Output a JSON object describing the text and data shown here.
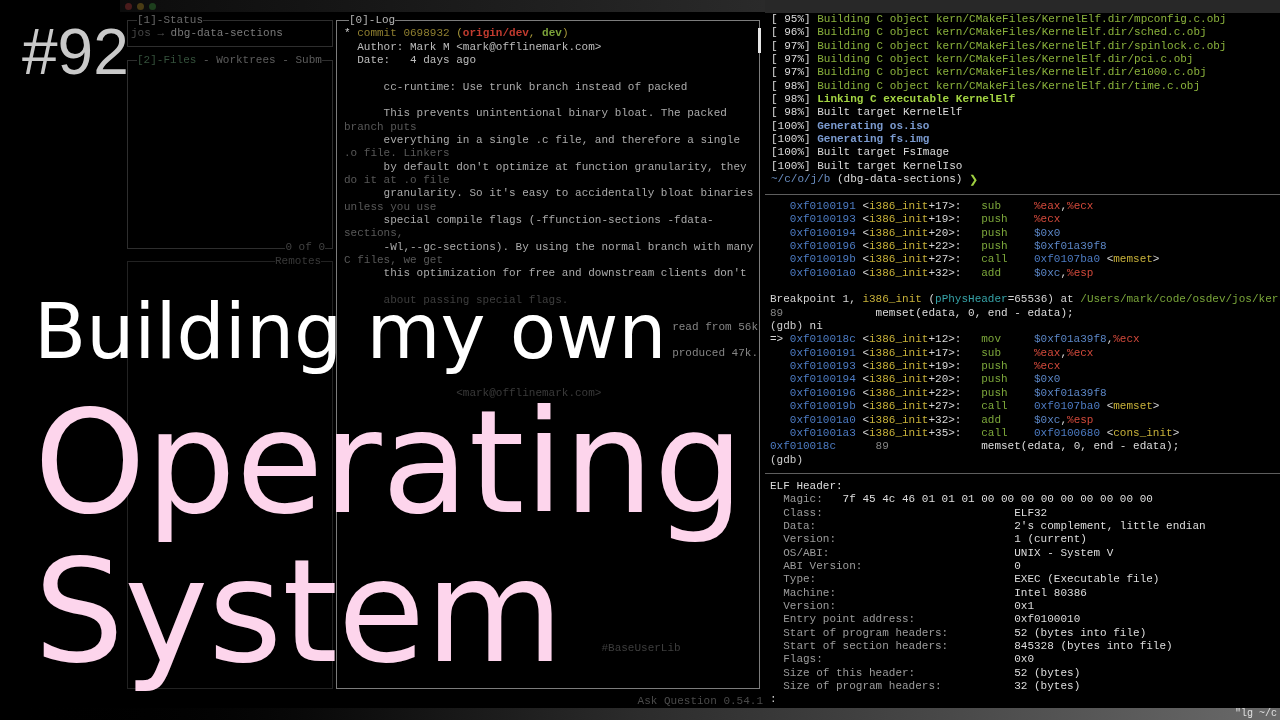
{
  "episode_number": "#92",
  "headline": {
    "intro": "Building my own",
    "title_lines": [
      "Operating",
      "System"
    ]
  },
  "lazygit": {
    "status_panel": {
      "title": "[1]-Status",
      "repo": "jos",
      "arrow": "→",
      "branch": "dbg-data-sections"
    },
    "files_panel": {
      "tabs": [
        {
          "label": "[2]-Files",
          "selected": true
        },
        {
          "label": "- Worktrees",
          "selected": false
        },
        {
          "label": "- Subm",
          "selected": false
        }
      ],
      "count": "0 of 0"
    },
    "branches_panel": {
      "title": "Remotes"
    },
    "log_panel": {
      "title": "[0]-Log",
      "lines": [
        {
          "kind": "commit",
          "segs": [
            {
              "kind": "graph",
              "text": "*"
            },
            {
              "kind": "hash",
              "text": " commit 0698932 "
            },
            {
              "kind": "punct",
              "text": "("
            },
            {
              "kind": "remote",
              "text": "origin/dev"
            },
            {
              "kind": "punct",
              "text": ", "
            },
            {
              "kind": "local",
              "text": "dev"
            },
            {
              "kind": "punct",
              "text": ")"
            }
          ]
        },
        {
          "kind": "meta",
          "text": "Author: Mark M <mark@offlinemark.com>"
        },
        {
          "kind": "meta",
          "text": "Date:   4 days ago"
        },
        {
          "kind": "blank"
        },
        {
          "kind": "body",
          "text": "cc-runtime: Use trunk branch instead of packed"
        },
        {
          "kind": "blank"
        },
        {
          "kind": "body",
          "text": "This prevents unintentional binary bloat. The packed"
        },
        {
          "kind": "wrap",
          "text": "branch puts"
        },
        {
          "kind": "body",
          "text": "everything in a single .c file, and therefore a single"
        },
        {
          "kind": "wrap",
          "text": ".o file. Linkers"
        },
        {
          "kind": "body",
          "text": "by default don't optimize at function granularity, they"
        },
        {
          "kind": "wrap",
          "text": "do it at .o file"
        },
        {
          "kind": "body",
          "text": "granularity. So it's easy to accidentally bloat binaries"
        },
        {
          "kind": "wrap",
          "text": "unless you use"
        },
        {
          "kind": "body",
          "text": "special compile flags (-ffunction-sections -fdata-"
        },
        {
          "kind": "wrap",
          "text": "sections,"
        },
        {
          "kind": "body",
          "text": "-Wl,--gc-sections). By using the normal branch with many"
        },
        {
          "kind": "wrap",
          "text": "C files, we get"
        },
        {
          "kind": "body",
          "text": "this optimization for free and downstream clients don't"
        },
        {
          "kind": "blank"
        },
        {
          "kind": "faded",
          "text": "about passing special flags."
        },
        {
          "kind": "blank"
        },
        {
          "kind": "tail",
          "text": "read from 56k"
        },
        {
          "kind": "blank"
        },
        {
          "kind": "tail",
          "text": "produced 47k."
        },
        {
          "kind": "blank"
        },
        {
          "kind": "blank"
        },
        {
          "kind": "faded_meta",
          "text": "<mark@offlinemark.com>"
        }
      ],
      "lower_fragment": "#BaseUserLib"
    },
    "footer": "Ask Question 0.54.1"
  },
  "terminal": {
    "build": {
      "lines": [
        {
          "progress": "[ 95%]",
          "kind": "compile",
          "message": "Building C object kern/CMakeFiles/KernelElf.dir/mpconfig.c.obj"
        },
        {
          "progress": "[ 96%]",
          "kind": "compile",
          "message": "Building C object kern/CMakeFiles/KernelElf.dir/sched.c.obj"
        },
        {
          "progress": "[ 97%]",
          "kind": "compile",
          "message": "Building C object kern/CMakeFiles/KernelElf.dir/spinlock.c.obj"
        },
        {
          "progress": "[ 97%]",
          "kind": "compile",
          "message": "Building C object kern/CMakeFiles/KernelElf.dir/pci.c.obj"
        },
        {
          "progress": "[ 97%]",
          "kind": "compile",
          "message": "Building C object kern/CMakeFiles/KernelElf.dir/e1000.c.obj"
        },
        {
          "progress": "[ 98%]",
          "kind": "compile",
          "message": "Building C object kern/CMakeFiles/KernelElf.dir/time.c.obj"
        },
        {
          "progress": "[ 98%]",
          "kind": "link",
          "message": "Linking C executable KernelElf"
        },
        {
          "progress": "[ 98%]",
          "kind": "built",
          "message": "Built target KernelElf"
        },
        {
          "progress": "[100%]",
          "kind": "generate",
          "message": "Generating os.iso"
        },
        {
          "progress": "[100%]",
          "kind": "generate",
          "message": "Generating fs.img"
        },
        {
          "progress": "[100%]",
          "kind": "built",
          "message": "Built target FsImage"
        },
        {
          "progress": "[100%]",
          "kind": "built",
          "message": "Built target KernelIso"
        }
      ],
      "prompt": {
        "path": "~/c/o/j/b",
        "branch": "(dbg-data-sections)",
        "symbol": "❯"
      }
    },
    "gdb": {
      "lines": [
        {
          "kind": "asm",
          "addr": "0xf0100191",
          "sym": [
            {
              "kind": "p",
              "text": "<"
            },
            {
              "kind": "fn",
              "text": "i386_init"
            },
            {
              "kind": "p",
              "text": "+17>:"
            }
          ],
          "op": "sub",
          "args": [
            {
              "kind": "reg",
              "text": "%eax"
            },
            {
              "kind": "p",
              "text": ","
            },
            {
              "kind": "reg",
              "text": "%ecx"
            }
          ]
        },
        {
          "kind": "asm",
          "addr": "0xf0100193",
          "sym": [
            {
              "kind": "p",
              "text": "<"
            },
            {
              "kind": "fn",
              "text": "i386_init"
            },
            {
              "kind": "p",
              "text": "+19>:"
            }
          ],
          "op": "push",
          "args": [
            {
              "kind": "reg",
              "text": "%ecx"
            }
          ]
        },
        {
          "kind": "asm",
          "addr": "0xf0100194",
          "sym": [
            {
              "kind": "p",
              "text": "<"
            },
            {
              "kind": "fn",
              "text": "i386_init"
            },
            {
              "kind": "p",
              "text": "+20>:"
            }
          ],
          "op": "push",
          "args": [
            {
              "kind": "imm",
              "text": "$0x0"
            }
          ]
        },
        {
          "kind": "asm",
          "addr": "0xf0100196",
          "sym": [
            {
              "kind": "p",
              "text": "<"
            },
            {
              "kind": "fn",
              "text": "i386_init"
            },
            {
              "kind": "p",
              "text": "+22>:"
            }
          ],
          "op": "push",
          "args": [
            {
              "kind": "imm",
              "text": "$0xf01a39f8"
            }
          ]
        },
        {
          "kind": "asm",
          "addr": "0xf010019b",
          "sym": [
            {
              "kind": "p",
              "text": "<"
            },
            {
              "kind": "fn",
              "text": "i386_init"
            },
            {
              "kind": "p",
              "text": "+27>:"
            }
          ],
          "op": "call",
          "args": [
            {
              "kind": "addr",
              "text": "0xf0107ba0"
            },
            {
              "kind": "p",
              "text": " <"
            },
            {
              "kind": "fn",
              "text": "memset"
            },
            {
              "kind": "p",
              "text": ">"
            }
          ]
        },
        {
          "kind": "asm",
          "addr": "0xf01001a0",
          "sym": [
            {
              "kind": "p",
              "text": "<"
            },
            {
              "kind": "fn",
              "text": "i386_init"
            },
            {
              "kind": "p",
              "text": "+32>:"
            }
          ],
          "op": "add",
          "args": [
            {
              "kind": "imm",
              "text": "$0xc"
            },
            {
              "kind": "p",
              "text": ","
            },
            {
              "kind": "reg",
              "text": "%esp"
            }
          ]
        },
        {
          "kind": "blank"
        },
        {
          "kind": "breakpoint",
          "segs": [
            {
              "kind": "p",
              "text": "Breakpoint 1, "
            },
            {
              "kind": "fn",
              "text": "i386_init"
            },
            {
              "kind": "p",
              "text": " ("
            },
            {
              "kind": "var",
              "text": "pPhysHeader"
            },
            {
              "kind": "p",
              "text": "=65536) at "
            },
            {
              "kind": "path",
              "text": "/Users/mark/code/osdev/jos/ker"
            }
          ]
        },
        {
          "kind": "source",
          "lineno": "89",
          "code": "memset(edata, 0, end - edata);"
        },
        {
          "kind": "prompt",
          "prompt": "(gdb)",
          "command": "ni"
        },
        {
          "kind": "asm",
          "marker": "=>",
          "addr": "0xf010018c",
          "sym": [
            {
              "kind": "p",
              "text": "<"
            },
            {
              "kind": "fn",
              "text": "i386_init"
            },
            {
              "kind": "p",
              "text": "+12>:"
            }
          ],
          "op": "mov",
          "args": [
            {
              "kind": "imm",
              "text": "$0xf01a39f8"
            },
            {
              "kind": "p",
              "text": ","
            },
            {
              "kind": "reg",
              "text": "%ecx"
            }
          ]
        },
        {
          "kind": "asm",
          "addr": "0xf0100191",
          "sym": [
            {
              "kind": "p",
              "text": "<"
            },
            {
              "kind": "fn",
              "text": "i386_init"
            },
            {
              "kind": "p",
              "text": "+17>:"
            }
          ],
          "op": "sub",
          "args": [
            {
              "kind": "reg",
              "text": "%eax"
            },
            {
              "kind": "p",
              "text": ","
            },
            {
              "kind": "reg",
              "text": "%ecx"
            }
          ]
        },
        {
          "kind": "asm",
          "addr": "0xf0100193",
          "sym": [
            {
              "kind": "p",
              "text": "<"
            },
            {
              "kind": "fn",
              "text": "i386_init"
            },
            {
              "kind": "p",
              "text": "+19>:"
            }
          ],
          "op": "push",
          "args": [
            {
              "kind": "reg",
              "text": "%ecx"
            }
          ]
        },
        {
          "kind": "asm",
          "addr": "0xf0100194",
          "sym": [
            {
              "kind": "p",
              "text": "<"
            },
            {
              "kind": "fn",
              "text": "i386_init"
            },
            {
              "kind": "p",
              "text": "+20>:"
            }
          ],
          "op": "push",
          "args": [
            {
              "kind": "imm",
              "text": "$0x0"
            }
          ]
        },
        {
          "kind": "asm",
          "addr": "0xf0100196",
          "sym": [
            {
              "kind": "p",
              "text": "<"
            },
            {
              "kind": "fn",
              "text": "i386_init"
            },
            {
              "kind": "p",
              "text": "+22>:"
            }
          ],
          "op": "push",
          "args": [
            {
              "kind": "imm",
              "text": "$0xf01a39f8"
            }
          ]
        },
        {
          "kind": "asm",
          "addr": "0xf010019b",
          "sym": [
            {
              "kind": "p",
              "text": "<"
            },
            {
              "kind": "fn",
              "text": "i386_init"
            },
            {
              "kind": "p",
              "text": "+27>:"
            }
          ],
          "op": "call",
          "args": [
            {
              "kind": "addr",
              "text": "0xf0107ba0"
            },
            {
              "kind": "p",
              "text": " <"
            },
            {
              "kind": "fn",
              "text": "memset"
            },
            {
              "kind": "p",
              "text": ">"
            }
          ]
        },
        {
          "kind": "asm",
          "addr": "0xf01001a0",
          "sym": [
            {
              "kind": "p",
              "text": "<"
            },
            {
              "kind": "fn",
              "text": "i386_init"
            },
            {
              "kind": "p",
              "text": "+32>:"
            }
          ],
          "op": "add",
          "args": [
            {
              "kind": "imm",
              "text": "$0xc"
            },
            {
              "kind": "p",
              "text": ","
            },
            {
              "kind": "reg",
              "text": "%esp"
            }
          ]
        },
        {
          "kind": "asm",
          "addr": "0xf01001a3",
          "sym": [
            {
              "kind": "p",
              "text": "<"
            },
            {
              "kind": "fn",
              "text": "i386_init"
            },
            {
              "kind": "p",
              "text": "+35>:"
            }
          ],
          "op": "call",
          "args": [
            {
              "kind": "addr",
              "text": "0xf0100680"
            },
            {
              "kind": "p",
              "text": " <"
            },
            {
              "kind": "fn",
              "text": "cons_init"
            },
            {
              "kind": "p",
              "text": ">"
            }
          ]
        },
        {
          "kind": "source",
          "addr": "0xf010018c",
          "lineno": "89",
          "code": "memset(edata, 0, end - edata);"
        },
        {
          "kind": "prompt",
          "prompt": "(gdb)"
        }
      ]
    },
    "readelf": {
      "title": "ELF Header:",
      "magic": {
        "label": "Magic:",
        "value": "7f 45 4c 46 01 01 01 00 00 00 00 00 00 00 00 00"
      },
      "fields": [
        {
          "label": "Class:",
          "value": "ELF32"
        },
        {
          "label": "Data:",
          "value": "2's complement, little endian"
        },
        {
          "label": "Version:",
          "value": "1 (current)"
        },
        {
          "label": "OS/ABI:",
          "value": "UNIX - System V"
        },
        {
          "label": "ABI Version:",
          "value": "0"
        },
        {
          "label": "Type:",
          "value": "EXEC (Executable file)"
        },
        {
          "label": "Machine:",
          "value": "Intel 80386"
        },
        {
          "label": "Version:",
          "value": "0x1"
        },
        {
          "label": "Entry point address:",
          "value": "0xf0100010"
        },
        {
          "label": "Start of program headers:",
          "value": "52 (bytes into file)"
        },
        {
          "label": "Start of section headers:",
          "value": "845328 (bytes into file)"
        },
        {
          "label": "Flags:",
          "value": "0x0"
        },
        {
          "label": "Size of this header:",
          "value": "52 (bytes)"
        },
        {
          "label": "Size of program headers:",
          "value": "32 (bytes)"
        }
      ],
      "pager": ":"
    },
    "status_bar": "\"lg ~/c"
  }
}
